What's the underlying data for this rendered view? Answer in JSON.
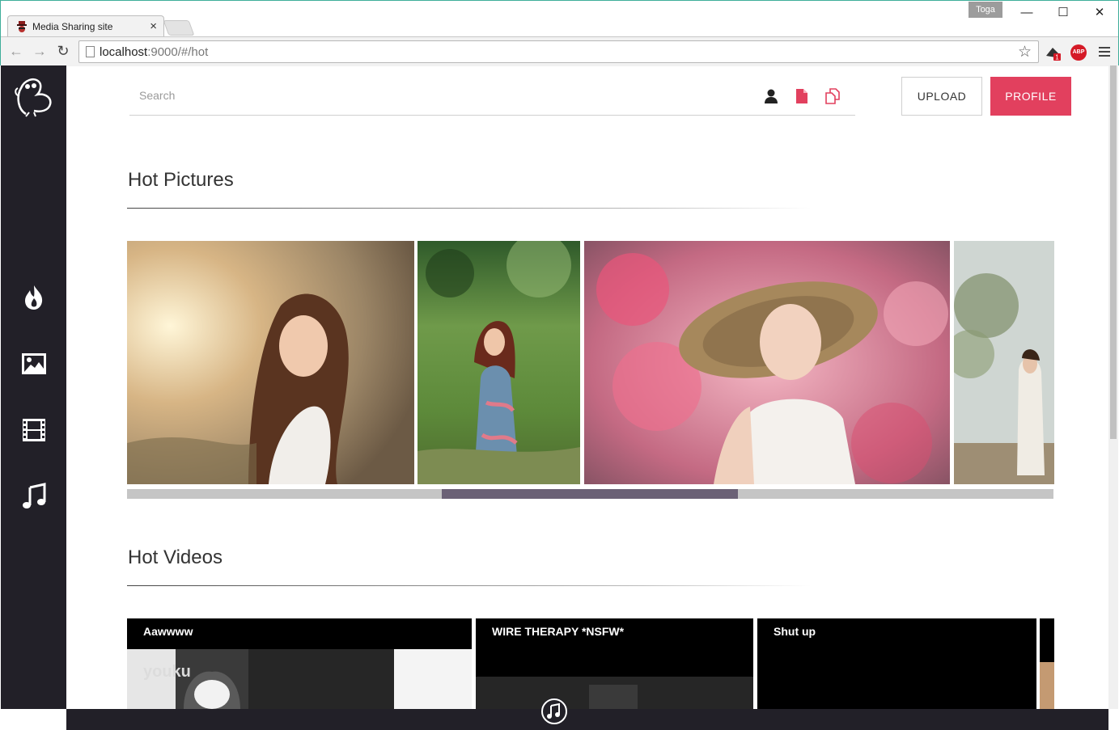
{
  "browser": {
    "tab_title": "Media Sharing site",
    "tab_close": "×",
    "profile_name": "Toga",
    "url_host": "localhost",
    "url_rest": ":9000/#/hot",
    "ext_abp": "ABP",
    "ext_badge": "1",
    "win_minimize": "—",
    "win_maximize": "☐",
    "win_close": "✕",
    "back": "←",
    "forward": "→",
    "reload": "↻",
    "star": "☆"
  },
  "header": {
    "search_placeholder": "Search",
    "filter_icons": [
      "user-filter-icon",
      "file-filter-icon",
      "multi-file-filter-icon"
    ],
    "upload_label": "UPLOAD",
    "profile_label": "PROFILE"
  },
  "sidebar": {
    "items": [
      {
        "icon": "fire-icon",
        "label": "Hot"
      },
      {
        "icon": "picture-icon",
        "label": "Pictures"
      },
      {
        "icon": "film-icon",
        "label": "Videos"
      },
      {
        "icon": "music-icon",
        "label": "Music"
      }
    ]
  },
  "hot_pictures": {
    "title": "Hot Pictures",
    "carousel_position": 0.34,
    "carousel_fraction": 0.32
  },
  "hot_videos": {
    "title": "Hot Videos",
    "items": [
      {
        "title": "Aawwww",
        "watermark": "youku"
      },
      {
        "title": "WIRE THERAPY *NSFW*"
      },
      {
        "title": "Shut up"
      }
    ]
  },
  "colors": {
    "accent": "#e2405e",
    "sidebar": "#222028",
    "carousel_thumb": "#6b6176"
  }
}
